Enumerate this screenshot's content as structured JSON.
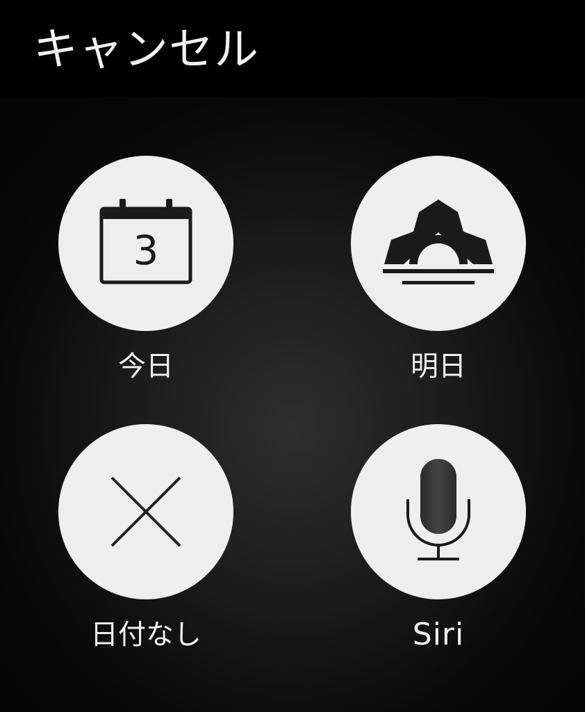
{
  "header": {
    "cancel_label": "キャンセル"
  },
  "options": [
    {
      "label": "今日",
      "icon": "calendar-icon",
      "calendar_day": "3"
    },
    {
      "label": "明日",
      "icon": "sunrise-icon"
    },
    {
      "label": "日付なし",
      "icon": "close-x-icon"
    },
    {
      "label": "Siri",
      "icon": "microphone-icon"
    }
  ],
  "colors": {
    "background": "#000000",
    "button_fill": "#eeeeee",
    "icon": "#1a1a1a",
    "text": "#f0f0f0"
  }
}
